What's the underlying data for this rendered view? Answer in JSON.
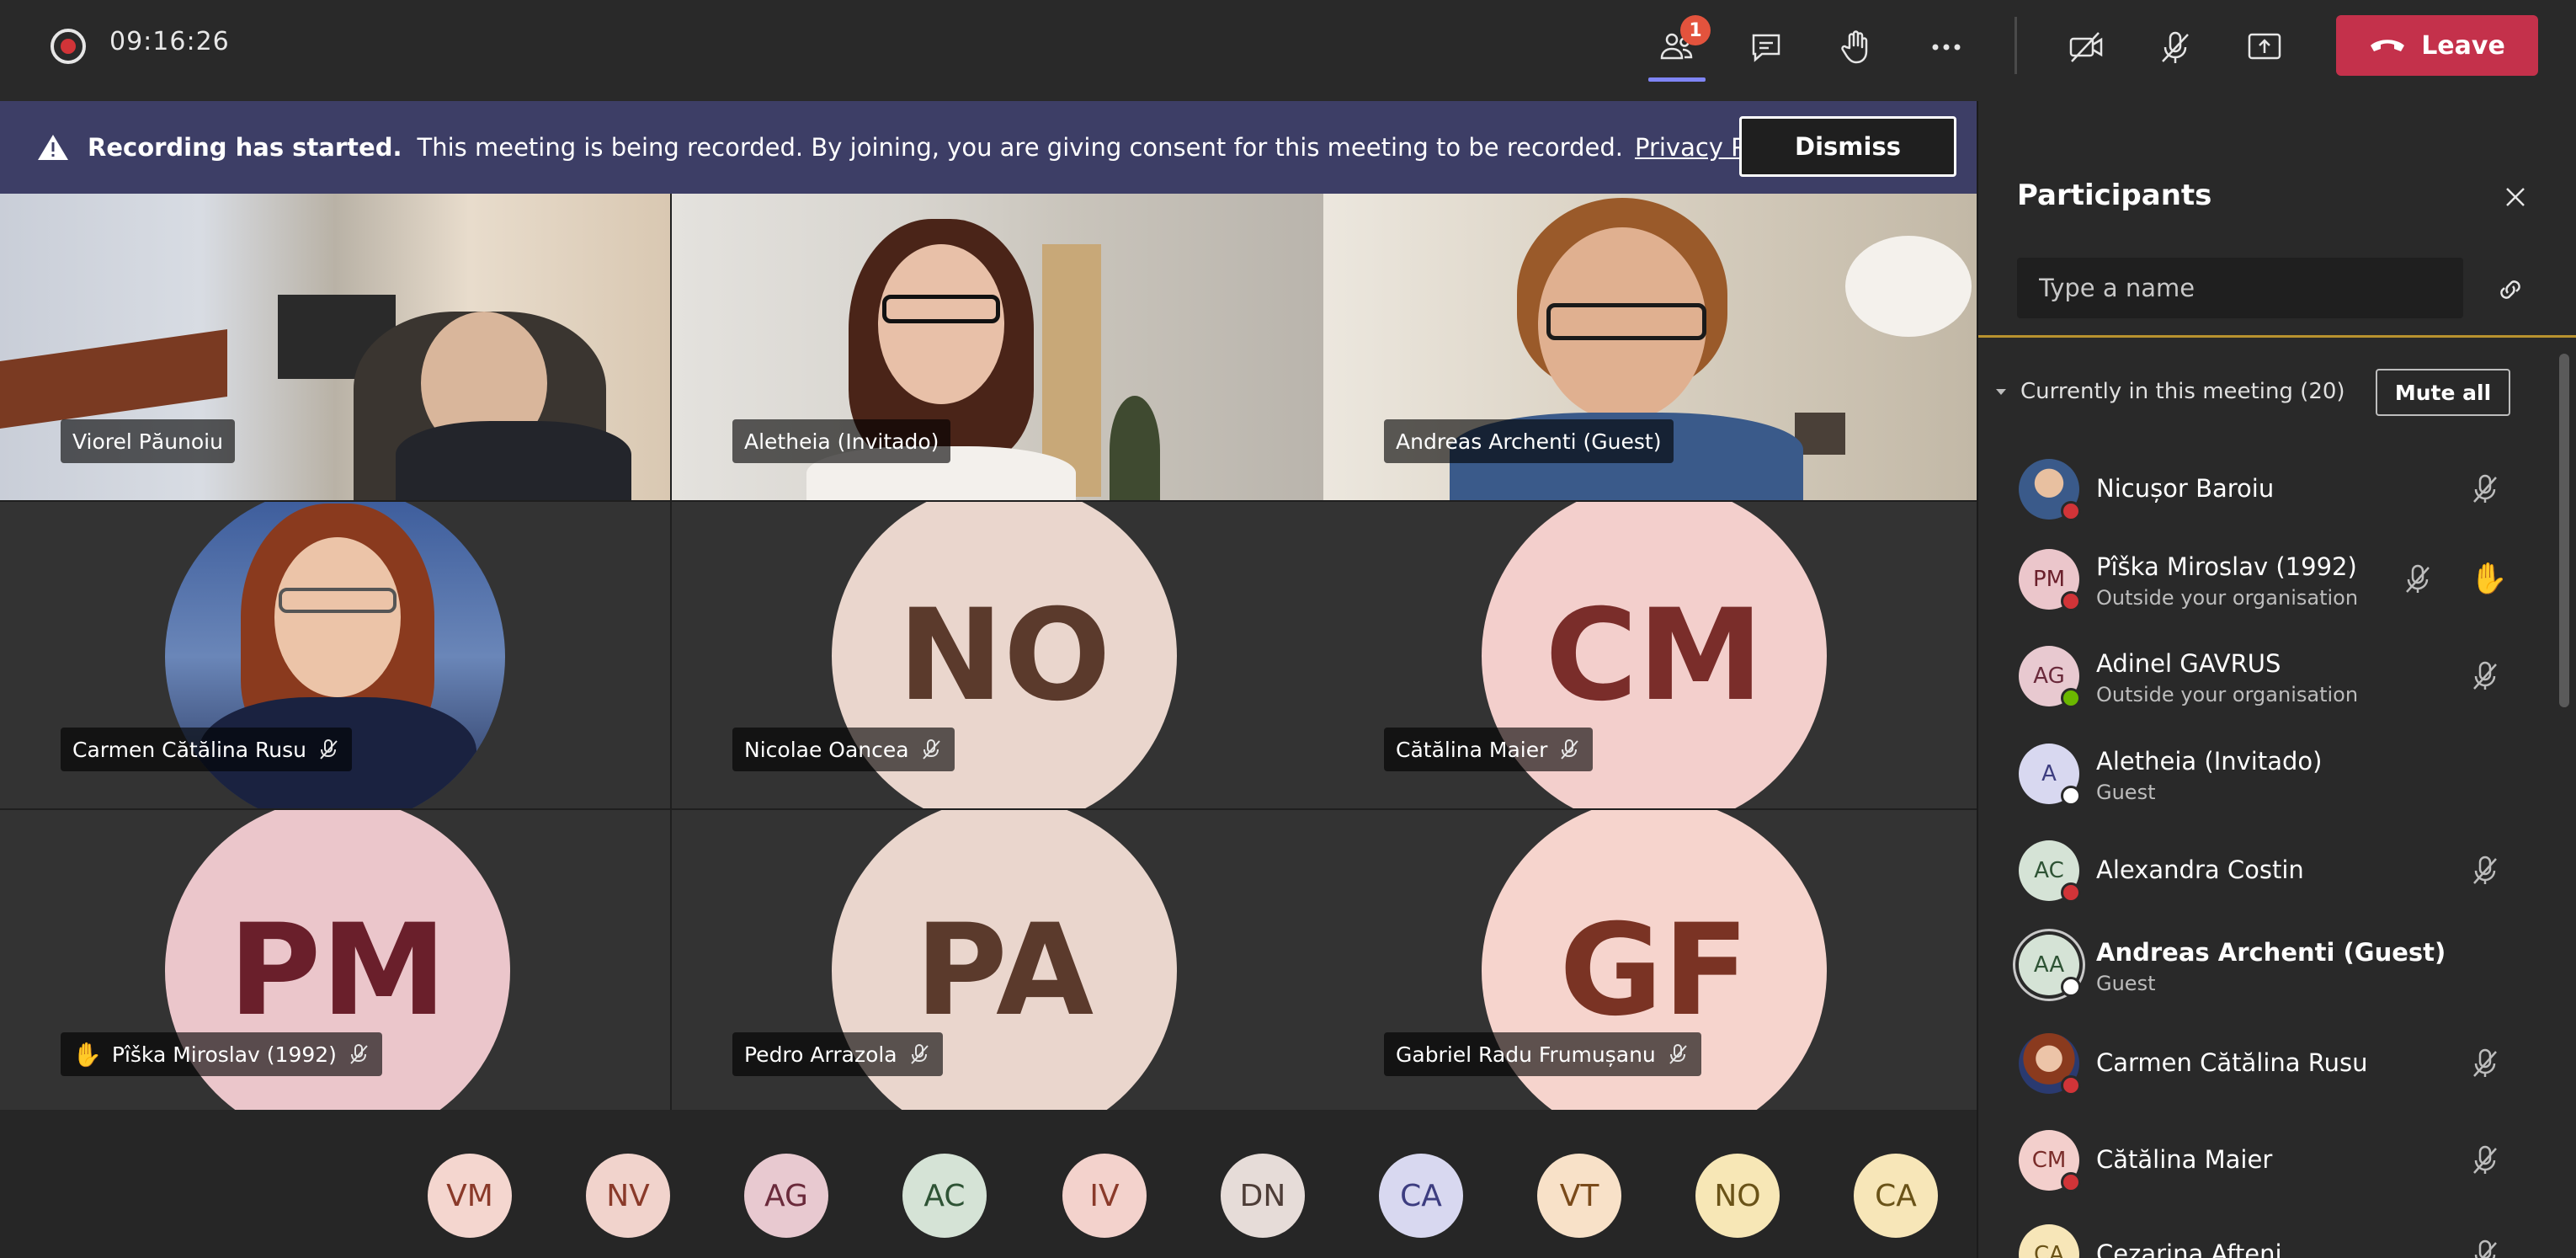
{
  "topbar": {
    "timer": "09:16:26",
    "participants_badge": "1",
    "leave_label": "Leave"
  },
  "banner": {
    "title": "Recording has started.",
    "message": "This meeting is being recorded. By joining, you are giving consent for this meeting to be recorded.",
    "policy_link": "Privacy Policy",
    "dismiss_label": "Dismiss"
  },
  "tiles": [
    {
      "name": "Viorel Păunoiu",
      "type": "video",
      "muted": false,
      "hand": false
    },
    {
      "name": "Aletheia (Invitado)",
      "type": "video",
      "muted": false,
      "hand": false
    },
    {
      "name": "Andreas Archenti (Guest)",
      "type": "video",
      "muted": false,
      "hand": false
    },
    {
      "name": "Carmen Cătălina Rusu",
      "type": "photo",
      "muted": true,
      "hand": false
    },
    {
      "name": "Nicolae Oancea",
      "type": "initials",
      "initials": "NO",
      "muted": true,
      "hand": false,
      "bg": "#ead6cd",
      "fg": "#5b3a2c"
    },
    {
      "name": "Cătălina Maier",
      "type": "initials",
      "initials": "CM",
      "muted": true,
      "hand": false,
      "bg": "#f3cfcc",
      "fg": "#7a2d2a"
    },
    {
      "name": "Pîška Miroslav (1992)",
      "type": "initials",
      "initials": "PM",
      "muted": true,
      "hand": true,
      "bg": "#ebc6cb",
      "fg": "#6a1f2b"
    },
    {
      "name": "Pedro Arrazola",
      "type": "initials",
      "initials": "PA",
      "muted": true,
      "hand": false,
      "bg": "#ead6cd",
      "fg": "#5b3a2c"
    },
    {
      "name": "Gabriel Radu Frumușanu",
      "type": "initials",
      "initials": "GF",
      "muted": true,
      "hand": false,
      "bg": "#f6d4cd",
      "fg": "#7a3324"
    }
  ],
  "filmstrip": [
    {
      "initials": "VM",
      "bg": "#f4d6cf",
      "fg": "#8a3a2a"
    },
    {
      "initials": "NV",
      "bg": "#f1d3cc",
      "fg": "#8a3a2a"
    },
    {
      "initials": "AG",
      "bg": "#e8c9d0",
      "fg": "#6a2a3b"
    },
    {
      "initials": "AC",
      "bg": "#d5e3d6",
      "fg": "#2e5335"
    },
    {
      "initials": "IV",
      "bg": "#f3d2cc",
      "fg": "#8a3a2a"
    },
    {
      "initials": "DN",
      "bg": "#e6dcd8",
      "fg": "#4d3d37"
    },
    {
      "initials": "CA",
      "bg": "#d8d8f0",
      "fg": "#3d3d80"
    },
    {
      "initials": "VT",
      "bg": "#f8e1c8",
      "fg": "#7a4a1a"
    },
    {
      "initials": "NO",
      "bg": "#f7e7b6",
      "fg": "#6a5318"
    },
    {
      "initials": "CA",
      "bg": "#f7e6b8",
      "fg": "#6a5318"
    }
  ],
  "panel": {
    "title": "Participants",
    "search_placeholder": "Type a name",
    "section_label": "Currently in this meeting (20)",
    "mute_all_label": "Mute all",
    "participants": [
      {
        "name": "Nicușor Baroiu",
        "sub": "",
        "avatar": "photo",
        "status": "#d13438",
        "muted": true,
        "hand": false,
        "bold": false
      },
      {
        "name": "Pîška Miroslav (1992)",
        "sub": "Outside your organisation",
        "avatar": "PM",
        "bg": "#ebc6cb",
        "fg": "#6a1f2b",
        "status": "#d13438",
        "muted": true,
        "hand": true,
        "bold": false
      },
      {
        "name": "Adinel GAVRUS",
        "sub": "Outside your organisation",
        "avatar": "AG",
        "bg": "#e8c9d0",
        "fg": "#6a2a3b",
        "status": "#6bb700",
        "muted": true,
        "hand": false,
        "bold": false
      },
      {
        "name": "Aletheia (Invitado)",
        "sub": "Guest",
        "avatar": "A",
        "bg": "#d8d8f0",
        "fg": "#3d3d80",
        "status": "#ffffff",
        "muted": false,
        "hand": false,
        "bold": false
      },
      {
        "name": "Alexandra Costin",
        "sub": "",
        "avatar": "AC",
        "bg": "#d5e3d6",
        "fg": "#2e5335",
        "status": "#d13438",
        "muted": true,
        "hand": false,
        "bold": false
      },
      {
        "name": "Andreas Archenti (Guest)",
        "sub": "Guest",
        "avatar": "AA",
        "bg": "#d5e3d6",
        "fg": "#2e5335",
        "status": "#ffffff",
        "muted": false,
        "hand": false,
        "bold": true
      },
      {
        "name": "Carmen Cătălina Rusu",
        "sub": "",
        "avatar": "photo",
        "status": "#d13438",
        "muted": true,
        "hand": false,
        "bold": false
      },
      {
        "name": "Cătălina Maier",
        "sub": "",
        "avatar": "CM",
        "bg": "#f3cfcc",
        "fg": "#7a2d2a",
        "status": "#d13438",
        "muted": true,
        "hand": false,
        "bold": false
      },
      {
        "name": "Cezarina Afteni",
        "sub": "",
        "avatar": "CA",
        "bg": "#f7e6b8",
        "fg": "#6a5318",
        "status": "#d13438",
        "muted": true,
        "hand": false,
        "bold": false
      }
    ]
  }
}
